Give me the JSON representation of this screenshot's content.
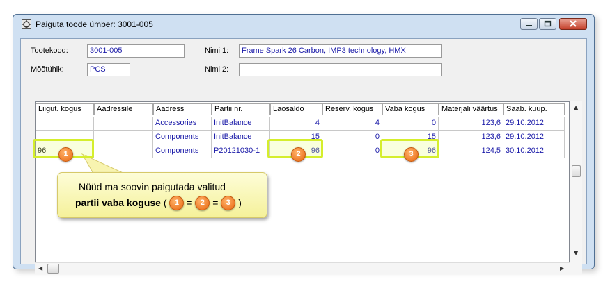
{
  "window": {
    "title": "Paiguta toode ümber: 3001-005"
  },
  "form": {
    "tootekood_label": "Tootekood:",
    "tootekood_value": "3001-005",
    "mootuhik_label": "Mõõtühik:",
    "mootuhik_value": "PCS",
    "nimi1_label": "Nimi 1:",
    "nimi1_value": "Frame Spark 26 Carbon, IMP3 technology, HMX",
    "nimi2_label": "Nimi 2:",
    "nimi2_value": ""
  },
  "grid": {
    "headers": [
      "Liigut. kogus",
      "Aadressile",
      "Aadress",
      "Partii nr.",
      "Laosaldo",
      "Reserv. kogus",
      "Vaba kogus",
      "Materjali väärtus",
      "Saab. kuup."
    ],
    "rows": [
      {
        "liigut": "",
        "aadressile": "",
        "aadress": "Accessories",
        "partii": "InitBalance",
        "laosaldo": "4",
        "reserv": "4",
        "vaba": "0",
        "vaartus": "123,6",
        "kuup": "29.10.2012"
      },
      {
        "liigut": "",
        "aadressile": "",
        "aadress": "Components",
        "partii": "InitBalance",
        "laosaldo": "15",
        "reserv": "0",
        "vaba": "15",
        "vaartus": "123,6",
        "kuup": "29.10.2012"
      },
      {
        "liigut": "96",
        "aadressile": "",
        "aadress": "Components",
        "partii": "P20121030-1",
        "laosaldo": "96",
        "reserv": "0",
        "vaba": "96",
        "vaartus": "124,5",
        "kuup": "30.10.2012"
      }
    ]
  },
  "annotation": {
    "badges": [
      "1",
      "2",
      "3"
    ],
    "line1": "Nüüd ma soovin paigutada valitud",
    "line2_bold": "partii vaba koguse",
    "line2_open": " ( ",
    "eq": " = ",
    "line2_close": " )"
  },
  "colors": {
    "highlight": "#d5ee2c",
    "badge": "#e8640d",
    "callout": "#f5f19a",
    "value_text": "#1a1aa8"
  }
}
